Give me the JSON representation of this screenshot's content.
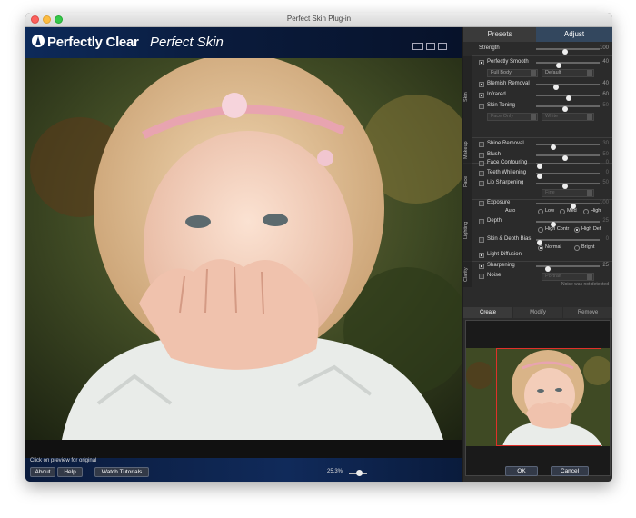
{
  "window": {
    "title": "Perfect Skin Plug-in"
  },
  "header": {
    "brand": "Perfectly Clear",
    "brand_sub": "Perfect Skin"
  },
  "preview": {
    "hint": "Click on preview for original"
  },
  "footer": {
    "about": "About",
    "help": "Help",
    "tutorials": "Watch Tutorials",
    "zoom": "25.3%"
  },
  "panel": {
    "tabs": {
      "presets": "Presets",
      "adjust": "Adjust"
    },
    "strength": {
      "label": "Strength",
      "value": "100",
      "level": 0.45
    },
    "sections": {
      "skin": "Skin",
      "makeup": "Makeup",
      "face": "Face",
      "lighting": "Lighting",
      "clarity": "Clarity"
    },
    "skin": {
      "perfectly_smooth": {
        "label": "Perfectly Smooth",
        "value": "40",
        "checked": true,
        "level": 0.35
      },
      "body_mode": "Full Body",
      "smooth_preset": "Default",
      "blemish_removal": {
        "label": "Blemish Removal",
        "value": "40",
        "checked": true,
        "level": 0.3
      },
      "infrared": {
        "label": "Infrared",
        "value": "60",
        "checked": true,
        "level": 0.52
      },
      "skin_toning": {
        "label": "Skin Toning",
        "value": "50",
        "checked": false,
        "level": 0.45
      },
      "toning_area": "Face Only",
      "toning_color": "White"
    },
    "makeup": {
      "shine_removal": {
        "label": "Shine Removal",
        "value": "30",
        "checked": false,
        "level": 0.25
      },
      "blush": {
        "label": "Blush",
        "value": "50",
        "checked": false,
        "level": 0.45
      }
    },
    "face": {
      "face_contouring": {
        "label": "Face Contouring",
        "value": "0",
        "checked": false,
        "level": 0.02
      },
      "teeth_whitening": {
        "label": "Teeth Whitening",
        "value": "0",
        "checked": false,
        "level": 0.02
      },
      "lip_sharpening": {
        "label": "Lip Sharpening",
        "value": "50",
        "checked": false,
        "level": 0.45
      },
      "lip_mode": "Fine"
    },
    "lighting": {
      "exposure": {
        "label": "Exposure",
        "value": "100",
        "checked": false,
        "level": 0.6
      },
      "auto_label": "Auto",
      "exposure_modes": [
        "Low",
        "Med",
        "High"
      ],
      "depth": {
        "label": "Depth",
        "value": "25",
        "checked": false,
        "level": 0.25
      },
      "depth_modes": [
        "High Contr",
        "High Def"
      ],
      "skin_depth_bias": {
        "label": "Skin & Depth Bias",
        "value": "0",
        "checked": false,
        "level": 0.02
      },
      "bias_modes": [
        "Normal",
        "Bright"
      ],
      "light_diffusion": {
        "label": "Light Diffusion",
        "checked": true
      }
    },
    "clarity": {
      "sharpening": {
        "label": "Sharpening",
        "value": "25",
        "checked": true,
        "level": 0.15
      },
      "noise": {
        "label": "Noise",
        "checked": false
      },
      "noise_mode": "Portrait",
      "noise_msg": "Noise was not detected"
    },
    "mask_tabs": {
      "create": "Create",
      "modify": "Modify",
      "remove": "Remove"
    },
    "ok": "OK",
    "cancel": "Cancel"
  },
  "colors": {
    "accent": "#33475e",
    "face_box": "#e0302a",
    "header": "#0d2a5a"
  }
}
